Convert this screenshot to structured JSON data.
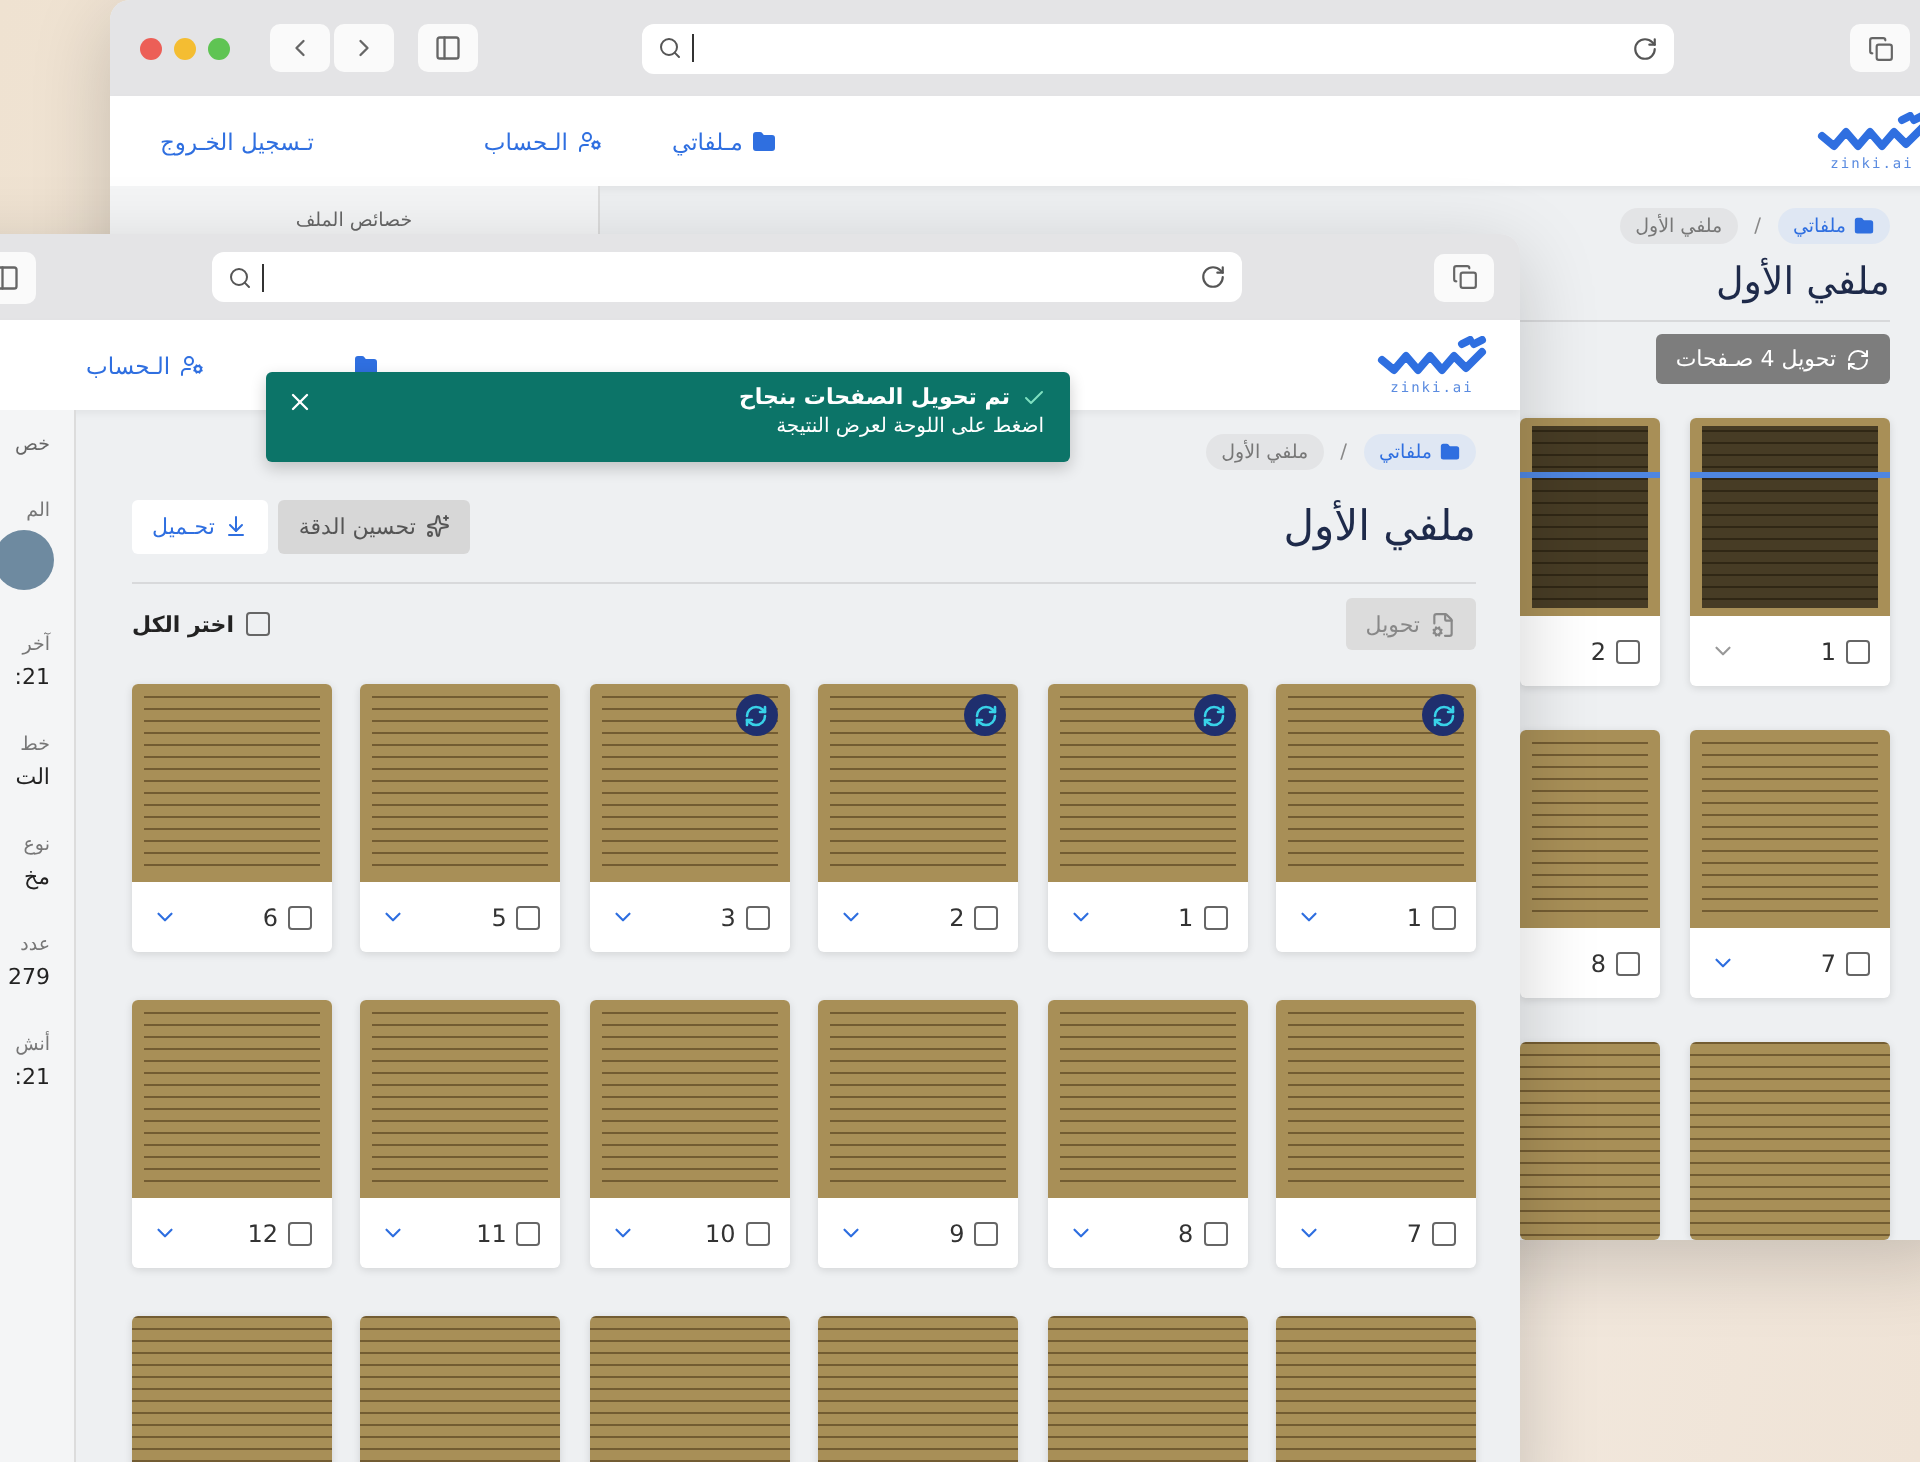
{
  "back_window": {
    "logo_caption": "zinki.ai",
    "nav": [
      {
        "kind": "files",
        "label": "مـلفاتي"
      },
      {
        "kind": "account",
        "label": "الـحساب"
      },
      {
        "kind": "logout",
        "label": "تـسجيل الخـروج"
      }
    ],
    "sidebar_title": "خصائص الملف",
    "breadcrumb": [
      {
        "kind": "home",
        "label": "ملفاتي"
      },
      {
        "kind": "current",
        "label": "ملفي الأول"
      }
    ],
    "breadcrumb_separator": "/",
    "title": "ملفي الأول",
    "convert_button": {
      "label": "تحويل 4 صـفحات",
      "disabled": false
    },
    "pages": [
      {
        "kind": "page",
        "number": "1",
        "checked": false,
        "scanning": true
      },
      {
        "kind": "page",
        "number": "2",
        "checked": false,
        "scanning": true,
        "cut": true
      },
      {
        "kind": "page",
        "number": "7",
        "checked": false,
        "scanning": false
      },
      {
        "kind": "page",
        "number": "8",
        "checked": false,
        "scanning": false,
        "cut": true
      },
      {
        "kind": "image"
      },
      {
        "kind": "image",
        "cut": true
      }
    ]
  },
  "front_window": {
    "logo_caption": "zinki.ai",
    "nav": [
      {
        "kind": "files"
      },
      {
        "kind": "account",
        "label": "الـحساب"
      }
    ],
    "toast": {
      "title": "تم تحويل الصفحات بنجاح",
      "message": "اضغط على اللوحة لعرض النتيجة"
    },
    "sidebar": {
      "title": "خص",
      "owner_label": "الم",
      "fields": [
        {
          "label": "آخر",
          "value": ":21"
        },
        {
          "label": "خط",
          "value": "الت"
        },
        {
          "label": "نوع",
          "value": "مخ"
        },
        {
          "label": "عدد",
          "value": "279"
        },
        {
          "label": "أنش",
          "value": ":21"
        }
      ]
    },
    "breadcrumb": [
      {
        "kind": "home",
        "label": "ملفاتي"
      },
      {
        "kind": "current",
        "label": "ملفي الأول"
      }
    ],
    "breadcrumb_separator": "/",
    "title": "ملفي الأول",
    "enhance_button": {
      "label": "تحسين الدقة",
      "disabled": true
    },
    "download_button": {
      "label": "تحـميل",
      "disabled": false
    },
    "convert_button": {
      "label": "تحويل",
      "disabled": true
    },
    "select_all": {
      "label": "اختر الكل",
      "checked": false
    },
    "pages": [
      {
        "kind": "page",
        "number": "1",
        "checked": false,
        "converted": true
      },
      {
        "kind": "page",
        "number": "1",
        "checked": false,
        "converted": true
      },
      {
        "kind": "page",
        "number": "2",
        "checked": false,
        "converted": true
      },
      {
        "kind": "page",
        "number": "3",
        "checked": false,
        "converted": true
      },
      {
        "kind": "page",
        "number": "5",
        "checked": false,
        "converted": false
      },
      {
        "kind": "page",
        "number": "6",
        "checked": false,
        "converted": false
      },
      {
        "kind": "page",
        "number": "7",
        "checked": false,
        "converted": false
      },
      {
        "kind": "page",
        "number": "8",
        "checked": false,
        "converted": false
      },
      {
        "kind": "page",
        "number": "9",
        "checked": false,
        "converted": false
      },
      {
        "kind": "page",
        "number": "10",
        "checked": false,
        "converted": false
      },
      {
        "kind": "page",
        "number": "11",
        "checked": false,
        "converted": false
      },
      {
        "kind": "page",
        "number": "12",
        "checked": false,
        "converted": false
      },
      {
        "kind": "image"
      },
      {
        "kind": "image"
      },
      {
        "kind": "image"
      },
      {
        "kind": "image"
      },
      {
        "kind": "image"
      },
      {
        "kind": "image"
      }
    ]
  }
}
